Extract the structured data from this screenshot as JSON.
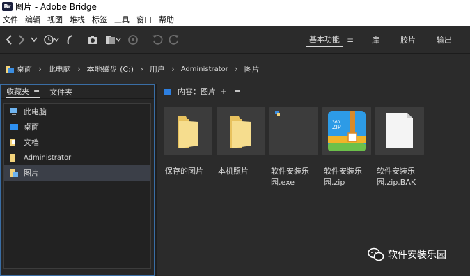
{
  "window": {
    "app_icon_text": "Br",
    "title": "图片 - Adobe Bridge"
  },
  "menubar": {
    "items": [
      "文件",
      "编辑",
      "视图",
      "堆栈",
      "标签",
      "工具",
      "窗口",
      "帮助"
    ]
  },
  "workspace": {
    "items": [
      {
        "label": "基本功能",
        "active": true
      },
      {
        "label": "库"
      },
      {
        "label": "胶片"
      },
      {
        "label": "输出"
      }
    ],
    "menu_glyph": "≡"
  },
  "breadcrumb": [
    "桌面",
    "此电脑",
    "本地磁盘 (C:)",
    "用户",
    "Administrator",
    "图片"
  ],
  "left_panel": {
    "tabs": [
      {
        "label": "收藏夹",
        "active": true
      },
      {
        "label": "文件夹"
      }
    ],
    "favorites": [
      {
        "label": "此电脑",
        "icon": "computer-icon"
      },
      {
        "label": "桌面",
        "icon": "desktop-icon"
      },
      {
        "label": "文档",
        "icon": "document-folder-icon"
      },
      {
        "label": "Administrator",
        "icon": "user-folder-icon"
      },
      {
        "label": "图片",
        "icon": "pictures-folder-icon",
        "selected": true
      }
    ]
  },
  "content": {
    "header": "内容：图片",
    "plus": "+",
    "menu_glyph": "≡",
    "items": [
      {
        "label": "保存的图片",
        "type": "folder"
      },
      {
        "label": "本机照片",
        "type": "folder"
      },
      {
        "label": "软件安装乐园.exe",
        "type": "exe"
      },
      {
        "label": "软件安装乐园.zip",
        "type": "zip"
      },
      {
        "label": "软件安装乐园.zip.BAK",
        "type": "blank"
      }
    ]
  },
  "watermark": "软件安装乐园",
  "colors": {
    "accent": "#2d7fe0",
    "folder": "#f3d37b",
    "selected_row": "#3b3f48",
    "panel_border": "#3a6ea5"
  }
}
